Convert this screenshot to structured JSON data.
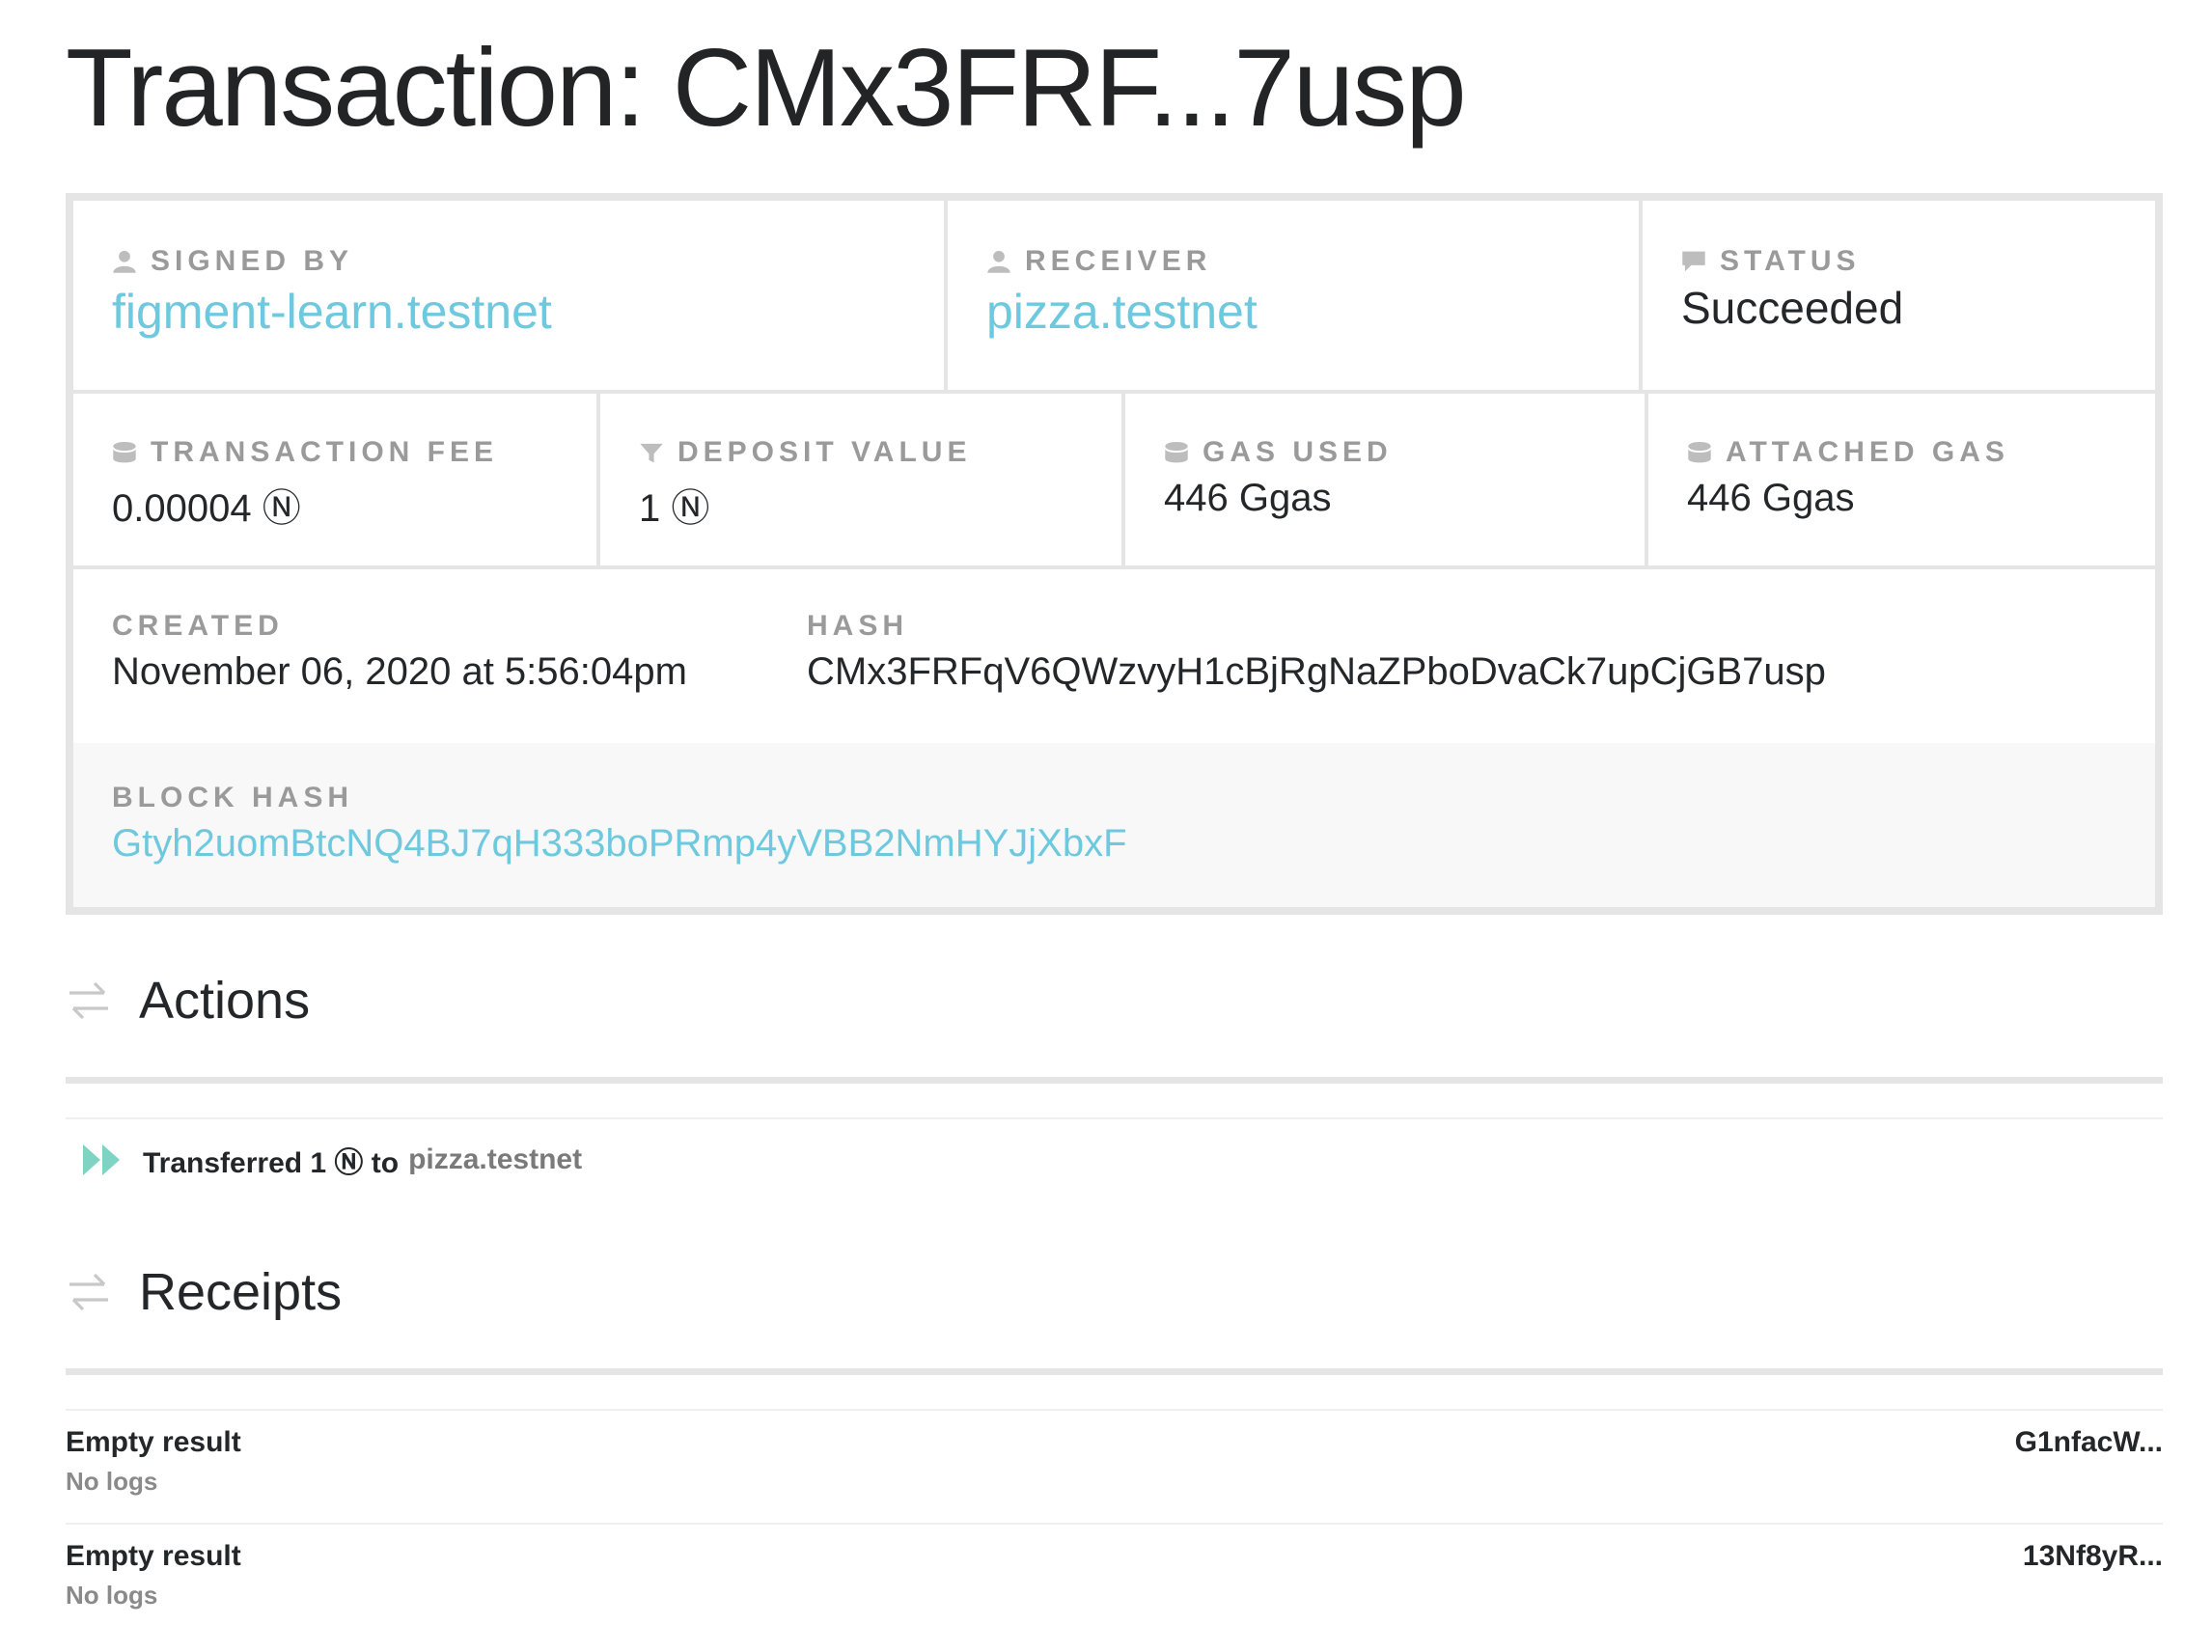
{
  "title": "Transaction: CMx3FRF...7usp",
  "card": {
    "signed_by": {
      "label": "SIGNED BY",
      "value": "figment-learn.testnet",
      "icon": "user-icon"
    },
    "receiver": {
      "label": "RECEIVER",
      "value": "pizza.testnet",
      "icon": "user-icon"
    },
    "status": {
      "label": "STATUS",
      "value": "Succeeded",
      "icon": "comment-icon"
    },
    "transaction_fee": {
      "label": "TRANSACTION FEE",
      "value": "0.00004 Ⓝ",
      "icon": "database-icon"
    },
    "deposit_value": {
      "label": "DEPOSIT VALUE",
      "value": "1 Ⓝ",
      "icon": "filter-icon"
    },
    "gas_used": {
      "label": "GAS USED",
      "value": "446 Ggas",
      "icon": "database-icon"
    },
    "attached_gas": {
      "label": "ATTACHED GAS",
      "value": "446 Ggas",
      "icon": "database-icon"
    },
    "created": {
      "label": "CREATED",
      "value": "November 06, 2020 at 5:56:04pm"
    },
    "hash": {
      "label": "HASH",
      "value": "CMx3FRFqV6QWzvyH1cBjRgNaZPboDvaCk7upCjGB7usp"
    },
    "block_hash": {
      "label": "BLOCK HASH",
      "value": "Gtyh2uomBtcNQ4BJ7qH333boPRmp4yVBB2NmHYJjXbxF"
    }
  },
  "actions": {
    "heading": "Actions",
    "items": [
      {
        "text": "Transferred 1 Ⓝ to",
        "target": "pizza.testnet"
      }
    ]
  },
  "receipts": {
    "heading": "Receipts",
    "items": [
      {
        "result": "Empty result",
        "logs": "No logs",
        "id": "G1nfacW..."
      },
      {
        "result": "Empty result",
        "logs": "No logs",
        "id": "13Nf8yR..."
      }
    ]
  },
  "colors": {
    "link": "#6ec9de",
    "border": "#e5e5e5",
    "label": "#9a9a9a",
    "action_icon": "#7fd3c3"
  }
}
